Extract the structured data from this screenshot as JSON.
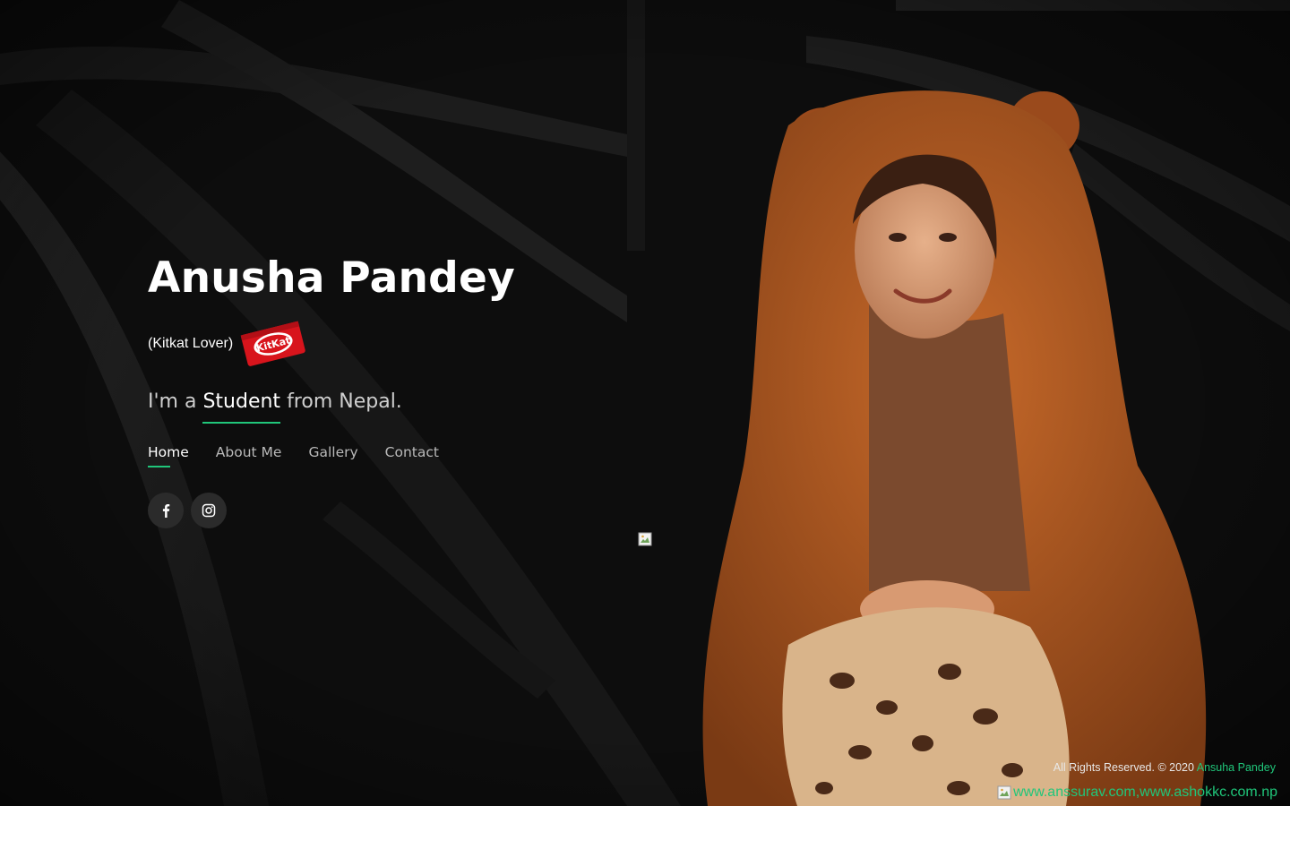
{
  "hero": {
    "name": "Anusha Pandey",
    "tagline": "(Kitkat Lover)",
    "intro_prefix": "I'm a",
    "intro_role": "Student",
    "intro_suffix": "from Nepal.",
    "kitkat_logo_text": "KitKat"
  },
  "nav": {
    "items": [
      {
        "label": "Home",
        "active": true
      },
      {
        "label": "About Me",
        "active": false
      },
      {
        "label": "Gallery",
        "active": false
      },
      {
        "label": "Contact",
        "active": false
      }
    ]
  },
  "socials": [
    {
      "icon": "facebook-icon"
    },
    {
      "icon": "instagram-icon"
    }
  ],
  "footer": {
    "rights": "All Rights Reserved. © 2020",
    "owner": "Ansuha Pandey",
    "credit_alt": "www.anssurav.com,www.ashokkc.com.np"
  },
  "colors": {
    "accent": "#20c67a",
    "background": "#0b0b0b",
    "text": "#ffffff",
    "muted": "#b9b9b9"
  }
}
